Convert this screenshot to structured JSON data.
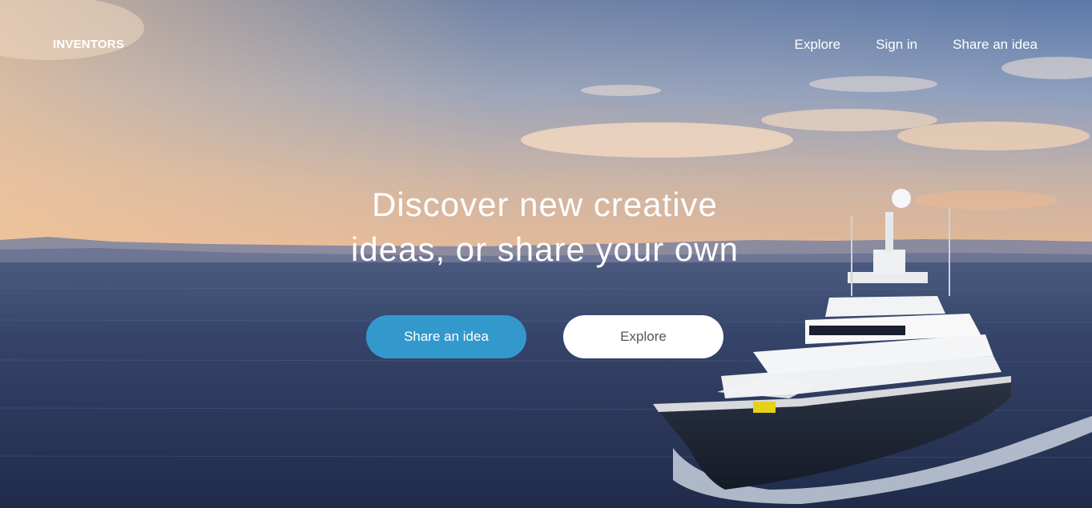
{
  "colors": {
    "primary_button": "#3399cc",
    "secondary_button": "#ffffff",
    "text_light": "#ffffff",
    "text_dark": "#555555"
  },
  "nav": {
    "brand": "INVENTORS",
    "links": [
      {
        "label": "Explore"
      },
      {
        "label": "Sign in"
      },
      {
        "label": "Share an idea"
      }
    ]
  },
  "hero": {
    "headline_line1": "Discover new creative",
    "headline_line2": "ideas, or share your own",
    "primary_cta": "Share an idea",
    "secondary_cta": "Explore",
    "background_image": "sunset-sea-yacht-photo"
  }
}
